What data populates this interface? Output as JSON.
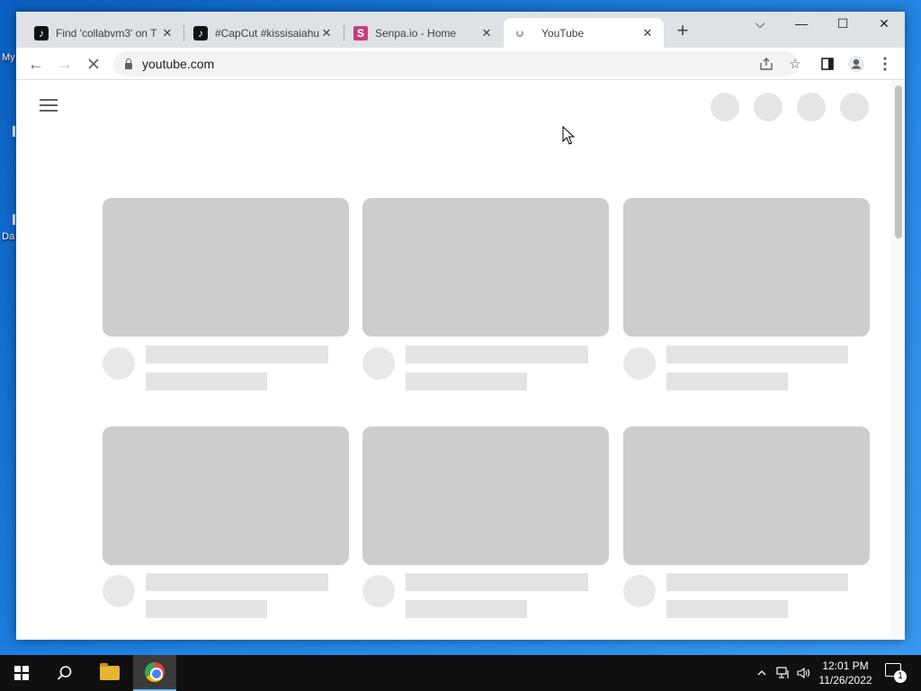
{
  "desktop": {
    "icon_label_1": "My",
    "icon_label_2": "Da"
  },
  "tabs": [
    {
      "title": "Find 'collabvm3' on T",
      "icon": "tiktok-icon",
      "close": "✕"
    },
    {
      "title": "#CapCut #kissisaiahu",
      "icon": "tiktok-icon",
      "close": "✕"
    },
    {
      "title": "Senpa.io - Home",
      "icon": "senpa-icon",
      "close": "✕"
    },
    {
      "title": "YouTube",
      "icon": "loading-icon",
      "close": "✕",
      "active": true
    }
  ],
  "new_tab_label": "+",
  "window_controls": {
    "tab_search": "⌵",
    "minimize": "—",
    "maximize": "☐",
    "close": "✕"
  },
  "toolbar": {
    "back": "←",
    "forward": "→",
    "reload_state": "loading",
    "url": "youtube.com",
    "share_icon": "share-icon",
    "bookmark_icon": "star-icon",
    "side_panel_icon": "side-panel-icon",
    "profile_icon": "profile-icon",
    "menu_icon": "kebab-menu-icon"
  },
  "page": {
    "state": "loading-skeleton",
    "header_placeholders": 4,
    "video_cards": 6
  },
  "taskbar": {
    "start_icon": "windows-start-icon",
    "search_icon": "search-icon",
    "explorer_icon": "file-explorer-icon",
    "chrome_icon": "chrome-icon",
    "clock_time": "12:01 PM",
    "clock_date": "11/26/2022",
    "notification_count": "1"
  }
}
